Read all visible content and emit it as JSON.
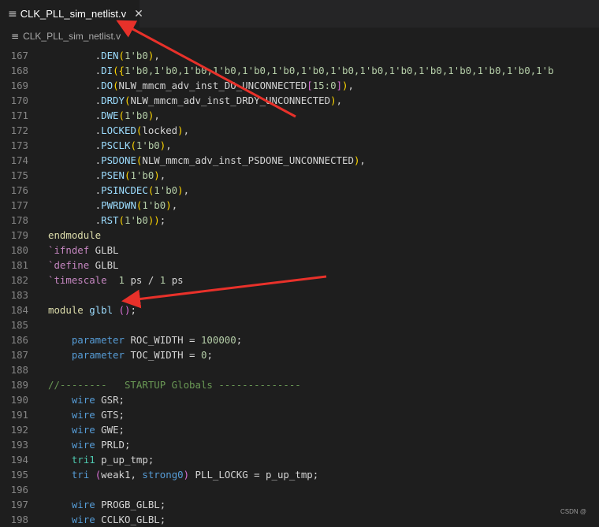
{
  "tab": {
    "icon": "lines-icon",
    "label": "CLK_PLL_sim_netlist.v",
    "close_icon": "close-icon"
  },
  "breadcrumb": {
    "icon": "lines-icon",
    "label": "CLK_PLL_sim_netlist.v"
  },
  "lines": [
    {
      "n": "167",
      "t": [
        [
          "p",
          "        ."
        ],
        [
          "f",
          "DEN"
        ],
        [
          "y",
          "("
        ],
        [
          "n",
          "1'b0"
        ],
        [
          "y",
          ")"
        ],
        [
          "p",
          ","
        ]
      ]
    },
    {
      "n": "168",
      "t": [
        [
          "p",
          "        ."
        ],
        [
          "f",
          "DI"
        ],
        [
          "y",
          "({"
        ],
        [
          "n",
          "1'b0,1'b0,1'b0,1'b0,1'b0,1'b0,1'b0,1'b0,1'b0,1'b0,1'b0,1'b0,1'b0,1'b0,1'b"
        ]
      ]
    },
    {
      "n": "169",
      "t": [
        [
          "p",
          "        ."
        ],
        [
          "f",
          "DO"
        ],
        [
          "y",
          "("
        ],
        [
          "p",
          "NLW_mmcm_adv_inst_DO_UNCONNECTED"
        ],
        [
          "v",
          "["
        ],
        [
          "n",
          "15:0"
        ],
        [
          "v",
          "]"
        ],
        [
          "y",
          ")"
        ],
        [
          "p",
          ","
        ]
      ]
    },
    {
      "n": "170",
      "t": [
        [
          "p",
          "        ."
        ],
        [
          "f",
          "DRDY"
        ],
        [
          "y",
          "("
        ],
        [
          "p",
          "NLW_mmcm_adv_inst_DRDY_UNCONNECTED"
        ],
        [
          "y",
          ")"
        ],
        [
          "p",
          ","
        ]
      ]
    },
    {
      "n": "171",
      "t": [
        [
          "p",
          "        ."
        ],
        [
          "f",
          "DWE"
        ],
        [
          "y",
          "("
        ],
        [
          "n",
          "1'b0"
        ],
        [
          "y",
          ")"
        ],
        [
          "p",
          ","
        ]
      ]
    },
    {
      "n": "172",
      "t": [
        [
          "p",
          "        ."
        ],
        [
          "f",
          "LOCKED"
        ],
        [
          "y",
          "("
        ],
        [
          "p",
          "locked"
        ],
        [
          "y",
          ")"
        ],
        [
          "p",
          ","
        ]
      ]
    },
    {
      "n": "173",
      "t": [
        [
          "p",
          "        ."
        ],
        [
          "f",
          "PSCLK"
        ],
        [
          "y",
          "("
        ],
        [
          "n",
          "1'b0"
        ],
        [
          "y",
          ")"
        ],
        [
          "p",
          ","
        ]
      ]
    },
    {
      "n": "174",
      "t": [
        [
          "p",
          "        ."
        ],
        [
          "f",
          "PSDONE"
        ],
        [
          "y",
          "("
        ],
        [
          "p",
          "NLW_mmcm_adv_inst_PSDONE_UNCONNECTED"
        ],
        [
          "y",
          ")"
        ],
        [
          "p",
          ","
        ]
      ]
    },
    {
      "n": "175",
      "t": [
        [
          "p",
          "        ."
        ],
        [
          "f",
          "PSEN"
        ],
        [
          "y",
          "("
        ],
        [
          "n",
          "1'b0"
        ],
        [
          "y",
          ")"
        ],
        [
          "p",
          ","
        ]
      ]
    },
    {
      "n": "176",
      "t": [
        [
          "p",
          "        ."
        ],
        [
          "f",
          "PSINCDEC"
        ],
        [
          "y",
          "("
        ],
        [
          "n",
          "1'b0"
        ],
        [
          "y",
          ")"
        ],
        [
          "p",
          ","
        ]
      ]
    },
    {
      "n": "177",
      "t": [
        [
          "p",
          "        ."
        ],
        [
          "f",
          "PWRDWN"
        ],
        [
          "y",
          "("
        ],
        [
          "n",
          "1'b0"
        ],
        [
          "y",
          ")"
        ],
        [
          "p",
          ","
        ]
      ]
    },
    {
      "n": "178",
      "t": [
        [
          "p",
          "        ."
        ],
        [
          "f",
          "RST"
        ],
        [
          "y",
          "("
        ],
        [
          "n",
          "1'b0"
        ],
        [
          "y",
          "))"
        ],
        [
          "p",
          ";"
        ]
      ]
    },
    {
      "n": "179",
      "t": [
        [
          "h",
          "endmodule"
        ]
      ]
    },
    {
      "n": "180",
      "t": [
        [
          "m",
          "`ifndef"
        ],
        [
          "p",
          " GLBL"
        ]
      ]
    },
    {
      "n": "181",
      "t": [
        [
          "m",
          "`define"
        ],
        [
          "p",
          " GLBL"
        ]
      ]
    },
    {
      "n": "182",
      "t": [
        [
          "m",
          "`timescale"
        ],
        [
          "p",
          "  "
        ],
        [
          "n",
          "1"
        ],
        [
          "p",
          " ps / "
        ],
        [
          "n",
          "1"
        ],
        [
          "p",
          " ps"
        ]
      ]
    },
    {
      "n": "183",
      "t": []
    },
    {
      "n": "184",
      "t": [
        [
          "h",
          "module"
        ],
        [
          "p",
          " "
        ],
        [
          "f",
          "glbl"
        ],
        [
          "p",
          " "
        ],
        [
          "v",
          "()"
        ],
        [
          "p",
          ";"
        ]
      ]
    },
    {
      "n": "185",
      "t": []
    },
    {
      "n": "186",
      "t": [
        [
          "p",
          "    "
        ],
        [
          "k",
          "parameter"
        ],
        [
          "p",
          " ROC_WIDTH = "
        ],
        [
          "n",
          "100000"
        ],
        [
          "p",
          ";"
        ]
      ]
    },
    {
      "n": "187",
      "t": [
        [
          "p",
          "    "
        ],
        [
          "k",
          "parameter"
        ],
        [
          "p",
          " TOC_WIDTH = "
        ],
        [
          "n",
          "0"
        ],
        [
          "p",
          ";"
        ]
      ]
    },
    {
      "n": "188",
      "t": []
    },
    {
      "n": "189",
      "t": [
        [
          "c",
          "//--------   STARTUP Globals --------------"
        ]
      ]
    },
    {
      "n": "190",
      "t": [
        [
          "p",
          "    "
        ],
        [
          "k",
          "wire"
        ],
        [
          "p",
          " GSR;"
        ]
      ]
    },
    {
      "n": "191",
      "t": [
        [
          "p",
          "    "
        ],
        [
          "k",
          "wire"
        ],
        [
          "p",
          " GTS;"
        ]
      ]
    },
    {
      "n": "192",
      "t": [
        [
          "p",
          "    "
        ],
        [
          "k",
          "wire"
        ],
        [
          "p",
          " GWE;"
        ]
      ]
    },
    {
      "n": "193",
      "t": [
        [
          "p",
          "    "
        ],
        [
          "k",
          "wire"
        ],
        [
          "p",
          " PRLD;"
        ]
      ]
    },
    {
      "n": "194",
      "t": [
        [
          "p",
          "    "
        ],
        [
          "t",
          "tri1"
        ],
        [
          "p",
          " p_up_tmp;"
        ]
      ]
    },
    {
      "n": "195",
      "t": [
        [
          "p",
          "    "
        ],
        [
          "k",
          "tri"
        ],
        [
          "p",
          " "
        ],
        [
          "v",
          "("
        ],
        [
          "p",
          "weak1, "
        ],
        [
          "k",
          "strong0"
        ],
        [
          "v",
          ")"
        ],
        [
          "p",
          " PLL_LOCKG = p_up_tmp;"
        ]
      ]
    },
    {
      "n": "196",
      "t": []
    },
    {
      "n": "197",
      "t": [
        [
          "p",
          "    "
        ],
        [
          "k",
          "wire"
        ],
        [
          "p",
          " PROGB_GLBL;"
        ]
      ]
    },
    {
      "n": "198",
      "t": [
        [
          "p",
          "    "
        ],
        [
          "k",
          "wire"
        ],
        [
          "p",
          " CCLKO_GLBL;"
        ]
      ]
    }
  ],
  "watermark": "CSDN @",
  "colors": {
    "arrow": "#e8312a",
    "background": "#1e1e1e"
  }
}
